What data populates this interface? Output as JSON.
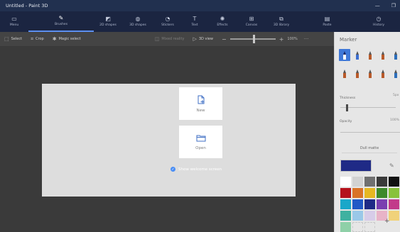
{
  "window": {
    "title": "Untitled - Paint 3D",
    "minimize_glyph": "—",
    "restore_glyph": "❐"
  },
  "ribbon": {
    "items": [
      {
        "label": "Menu",
        "icon": "folder-icon",
        "glyph": "▭",
        "active": false
      },
      {
        "label": "Brushes",
        "icon": "brush-icon",
        "glyph": "✎",
        "active": true
      },
      {
        "label": "2D shapes",
        "icon": "2d-shapes-icon",
        "glyph": "◩",
        "active": false
      },
      {
        "label": "3D shapes",
        "icon": "3d-shapes-icon",
        "glyph": "◍",
        "active": false
      },
      {
        "label": "Stickers",
        "icon": "sticker-icon",
        "glyph": "◔",
        "active": false
      },
      {
        "label": "Text",
        "icon": "text-icon",
        "glyph": "T",
        "active": false
      },
      {
        "label": "Effects",
        "icon": "effects-icon",
        "glyph": "✺",
        "active": false
      },
      {
        "label": "Canvas",
        "icon": "canvas-icon",
        "glyph": "⊞",
        "active": false
      },
      {
        "label": "3D library",
        "icon": "library-icon",
        "glyph": "⧉",
        "active": false
      },
      {
        "label": "Paste",
        "icon": "paste-icon",
        "glyph": "▤",
        "active": false
      },
      {
        "label": "History",
        "icon": "history-icon",
        "glyph": "◷",
        "active": false
      }
    ]
  },
  "toolbar": {
    "select": "Select",
    "crop": "Crop",
    "magic_select": "Magic select",
    "mixed_reality": "Mixed reality",
    "view_3d": "3D view",
    "zoom_percent": "100%",
    "zoom_level": 0.52,
    "minus": "−",
    "plus": "+",
    "more": "···"
  },
  "welcome": {
    "new_label": "New",
    "open_label": "Open",
    "show_welcome_label": "Show welcome screen",
    "show_welcome_checked": true
  },
  "panel": {
    "title": "Marker",
    "brushes": [
      {
        "name": "marker",
        "color": "#2f2f2f",
        "selected": true
      },
      {
        "name": "calligraphy-pen",
        "color": "#3d6fd0",
        "selected": false
      },
      {
        "name": "oil-brush",
        "color": "#b85a2a",
        "selected": false
      },
      {
        "name": "watercolor",
        "color": "#b85a2a",
        "selected": false
      },
      {
        "name": "pixel-pen",
        "color": "#2e6fba",
        "selected": false
      },
      {
        "name": "pencil",
        "color": "#b85a2a",
        "selected": false
      },
      {
        "name": "eraser",
        "color": "#b85a2a",
        "selected": false
      },
      {
        "name": "crayon",
        "color": "#b85a2a",
        "selected": false
      },
      {
        "name": "spray-can",
        "color": "#b85a2a",
        "selected": false
      },
      {
        "name": "fill",
        "color": "#2e6fba",
        "selected": false
      }
    ],
    "thickness_label": "Thickness",
    "thickness_value": "5px",
    "thickness_level": 0.1,
    "opacity_label": "Opacity",
    "opacity_value": "100%",
    "opacity_level": 1.0,
    "finish": "Dull matte",
    "current_color": "#1f2a86",
    "palette": [
      "#ffffff",
      "#d2d2d2",
      "#707070",
      "#3a3a3a",
      "#111111",
      "#b5121b",
      "#d97328",
      "#e6b822",
      "#3d8a2a",
      "#88c23a",
      "#19a7c9",
      "#2159c6",
      "#1f2a86",
      "#7a3fb0",
      "#c23b8a",
      "#3fb1a0",
      "#9ac8e8",
      "#d7cce8",
      "#e8b3c7",
      "#f0d27a",
      "#8fd0a8",
      "empty",
      "empty"
    ],
    "add_color": "+"
  },
  "colors": {
    "accent": "#5b8ff0",
    "titlebar_bg": "#21304f",
    "ribbon_bg": "#1b2541",
    "canvas_bg": "#3a3a3a",
    "welcome_bg": "#dddddd"
  }
}
